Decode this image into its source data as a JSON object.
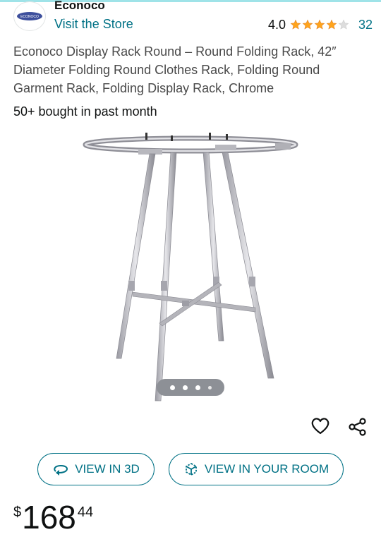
{
  "header": {
    "brand_name": "Econoco",
    "logo_text": "ECONOCO",
    "visit_store": "Visit the Store",
    "rating": "4.0",
    "stars": 4,
    "rating_count": "32"
  },
  "product": {
    "title": "Econoco Display Rack Round – Round Folding Rack, 42″ Diameter Folding Round Clothes Rack, Folding Round Garment Rack, Folding Display Rack, Chrome",
    "bought": "50+ bought in past month"
  },
  "gallery": {
    "total_images": 4,
    "active_index": 0
  },
  "actions": {
    "view_3d": "VIEW IN 3D",
    "view_room": "VIEW IN YOUR ROOM"
  },
  "price": {
    "symbol": "$",
    "whole": "168",
    "fraction": "44"
  },
  "colors": {
    "link": "#007185",
    "star": "#ffa41c",
    "star_empty": "#dddddd"
  }
}
